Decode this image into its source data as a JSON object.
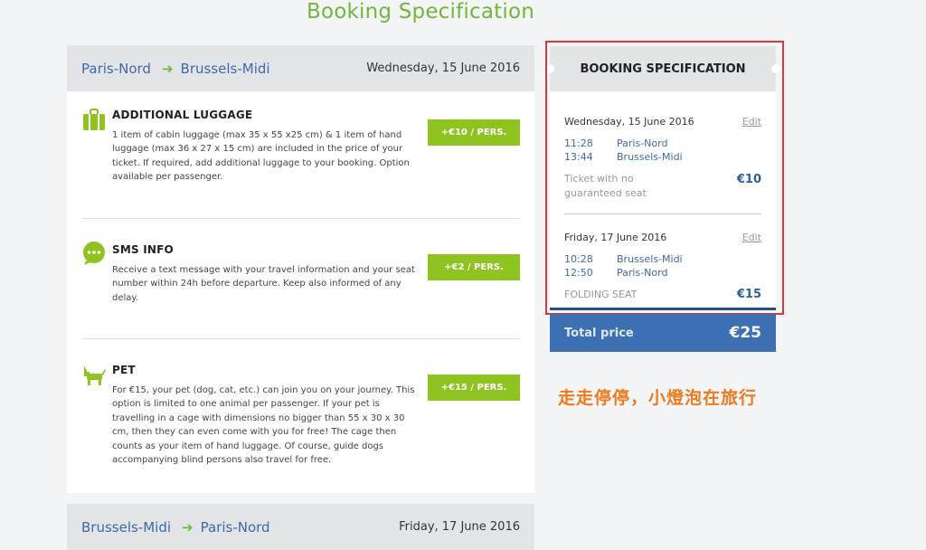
{
  "page": {
    "title": "Booking Specification"
  },
  "outbound": {
    "from": "Paris-Nord",
    "to": "Brussels-Midi",
    "date": "Wednesday, 15 June 2016"
  },
  "options": [
    {
      "icon": "luggage-icon",
      "title": "ADDITIONAL LUGGAGE",
      "text": "1 item of cabin luggage (max 35 x 55 x25 cm) & 1 item of hand luggage (max 36 x 27 x 15 cm) are included in the price of your ticket. If required, add additional luggage to your booking. Option available per passenger.",
      "button": "+€10 / PERS."
    },
    {
      "icon": "sms-icon",
      "title": "SMS INFO",
      "text": "Receive a text message with your travel information and your seat number within 24h before departure. Keep also informed of any delay.",
      "button": "+€2 / PERS."
    },
    {
      "icon": "pet-icon",
      "title": "PET",
      "text": "For €15, your pet (dog, cat, etc.) can join you on your journey. This option is limited to one animal per passenger. If your pet is travelling in a cage with dimensions no bigger than 55 x 30 x 30 cm, then they can even come with you for free! The cage then counts as your item of hand luggage. Of course, guide dogs accompanying blind persons also travel for free.",
      "button": "+€15 / PERS."
    }
  ],
  "return": {
    "from": "Brussels-Midi",
    "to": "Paris-Nord",
    "date": "Friday, 17 June 2016"
  },
  "spec": {
    "heading": "BOOKING SPECIFICATION",
    "edit_label": "Edit",
    "segments": [
      {
        "date": "Wednesday, 15 June 2016",
        "dep_time": "11:28",
        "dep_station": "Paris-Nord",
        "arr_time": "13:44",
        "arr_station": "Brussels-Midi",
        "fare": "Ticket with no guaranteed seat",
        "price": "€10"
      },
      {
        "date": "Friday, 17 June 2016",
        "dep_time": "10:28",
        "dep_station": "Brussels-Midi",
        "arr_time": "12:50",
        "arr_station": "Paris-Nord",
        "fare": "FOLDING SEAT",
        "price": "€15"
      }
    ]
  },
  "total": {
    "label": "Total price",
    "value": "€25"
  },
  "watermark": "走走停停，小燈泡在旅行",
  "colors": {
    "accent_green": "#8fc31f",
    "link_blue": "#3d6aa8",
    "total_blue": "#3d6fb3",
    "highlight_red": "#d83a3a",
    "watermark_orange": "#f07a1e"
  }
}
